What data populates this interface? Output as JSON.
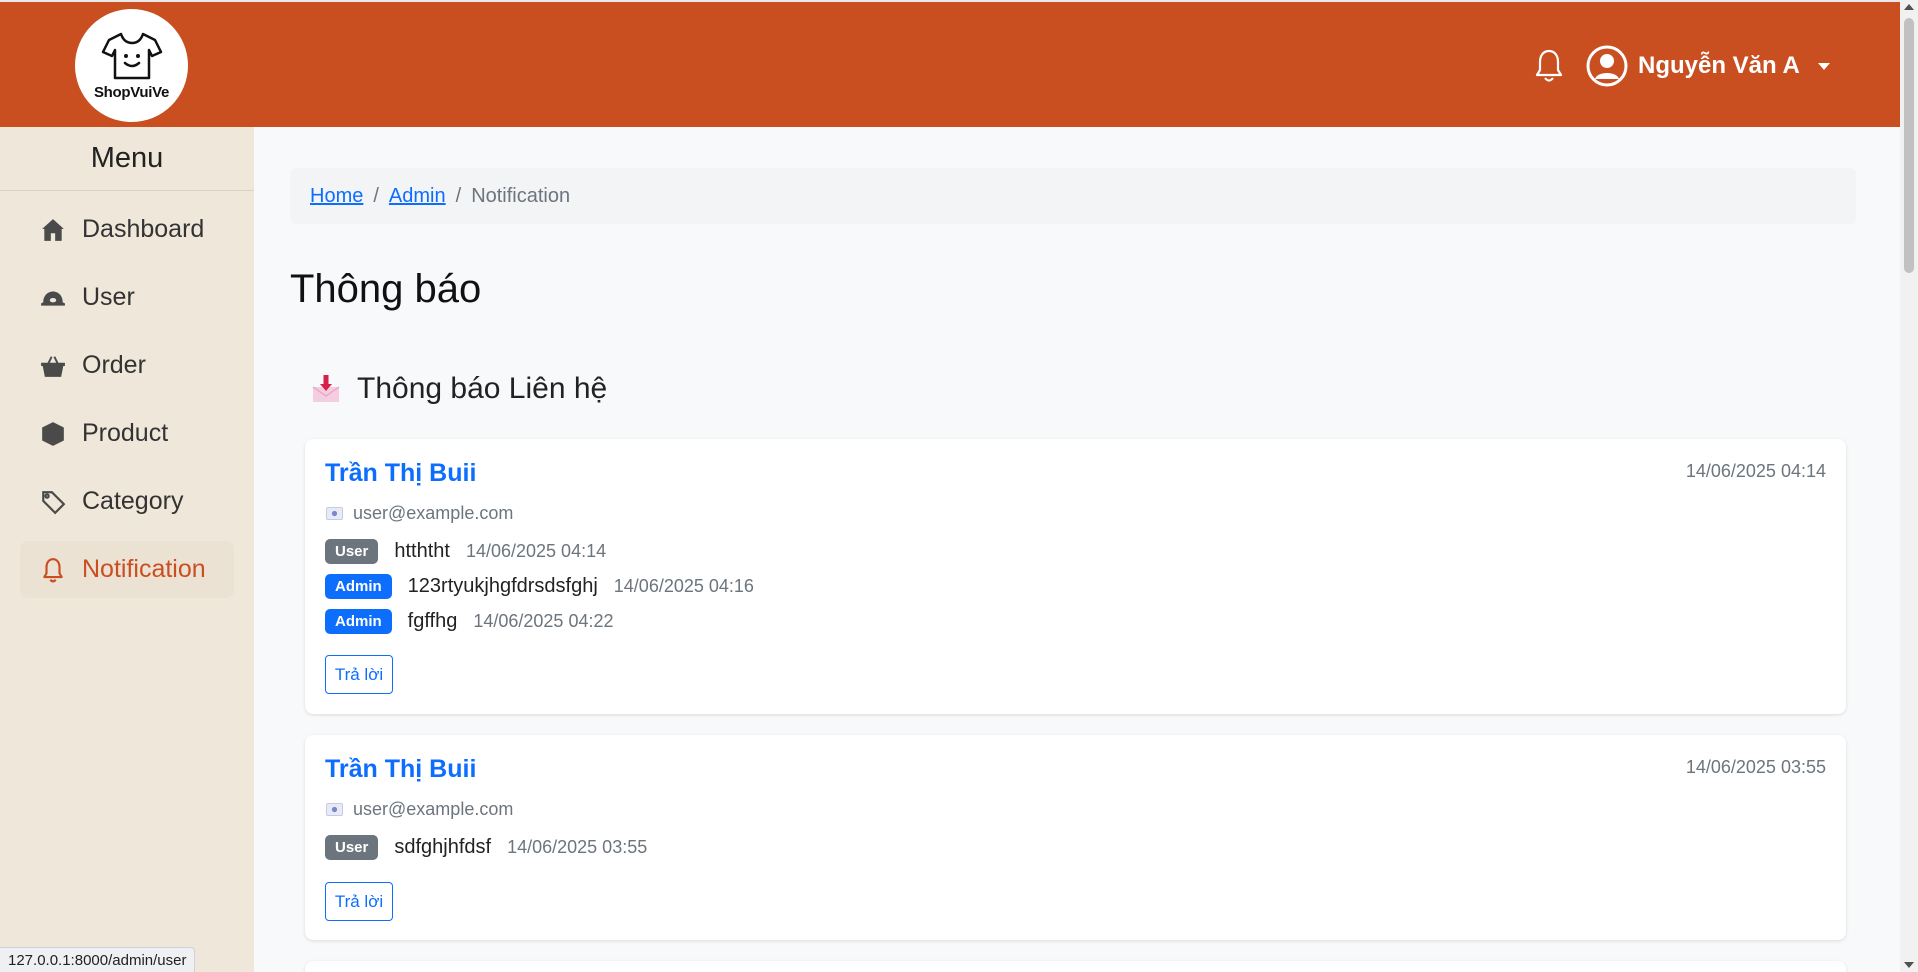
{
  "header": {
    "logo_text": "ShopVuiVe",
    "user_name": "Nguyễn Văn A"
  },
  "sidebar": {
    "title": "Menu",
    "items": [
      {
        "label": "Dashboard",
        "icon": "home-icon"
      },
      {
        "label": "User",
        "icon": "user-hat-icon"
      },
      {
        "label": "Order",
        "icon": "basket-icon"
      },
      {
        "label": "Product",
        "icon": "box-icon"
      },
      {
        "label": "Category",
        "icon": "tag-icon"
      },
      {
        "label": "Notification",
        "icon": "bell-icon",
        "active": true
      }
    ]
  },
  "breadcrumb": {
    "home": "Home",
    "admin": "Admin",
    "current": "Notification",
    "sep": "/"
  },
  "page": {
    "title": "Thông báo",
    "section_title": "Thông báo Liên hệ"
  },
  "notifications": [
    {
      "sender": "Trần Thị Buii",
      "email": "user@example.com",
      "time": "14/06/2025 04:14",
      "messages": [
        {
          "role": "User",
          "text": "htththt",
          "time": "14/06/2025 04:14"
        },
        {
          "role": "Admin",
          "text": "123rtyukjhgfdrsdsfghj",
          "time": "14/06/2025 04:16"
        },
        {
          "role": "Admin",
          "text": "fgffhg",
          "time": "14/06/2025 04:22"
        }
      ],
      "reply_label": "Trả lời"
    },
    {
      "sender": "Trần Thị Buii",
      "email": "user@example.com",
      "time": "14/06/2025 03:55",
      "messages": [
        {
          "role": "User",
          "text": "sdfghjhfdsf",
          "time": "14/06/2025 03:55"
        }
      ],
      "reply_label": "Trả lời"
    }
  ],
  "status_url": "127.0.0.1:8000/admin/user",
  "colors": {
    "header": "#c94f21",
    "sidebar": "#eee7da",
    "link": "#0d6efd",
    "badge_user": "#6c757d",
    "badge_admin": "#0d6efd"
  }
}
